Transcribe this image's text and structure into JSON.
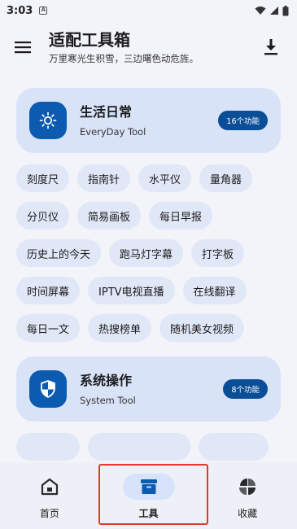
{
  "status_bar": {
    "time": "3:03",
    "notification_icon": "a-badge-icon",
    "wifi_icon": "wifi-icon",
    "signal_icon": "signal-icon",
    "battery_icon": "battery-icon"
  },
  "app_bar": {
    "title": "适配工具箱",
    "subtitle": "万里寒光生积雪，三边曙色动危旌。",
    "menu_icon": "menu-icon",
    "download_icon": "download-icon"
  },
  "categories": [
    {
      "title": "生活日常",
      "subtitle": "EveryDay Tool",
      "badge": "16个功能",
      "icon": "sun-icon",
      "tools": [
        "刻度尺",
        "指南针",
        "水平仪",
        "量角器",
        "分贝仪",
        "简易画板",
        "每日早报",
        "历史上的今天",
        "跑马灯字幕",
        "打字板",
        "时间屏幕",
        "IPTV电视直播",
        "在线翻译",
        "每日一文",
        "热搜榜单",
        "随机美女视频"
      ]
    },
    {
      "title": "系统操作",
      "subtitle": "System Tool",
      "badge": "8个功能",
      "icon": "shield-icon",
      "tools": []
    }
  ],
  "bottom_nav": {
    "items": [
      {
        "label": "首页",
        "icon": "home-icon",
        "active": false
      },
      {
        "label": "工具",
        "icon": "toolbox-icon",
        "active": true
      },
      {
        "label": "收藏",
        "icon": "favorites-icon",
        "active": false
      }
    ]
  },
  "colors": {
    "accent": "#0b5bb0",
    "card_bg": "#d9e3f8",
    "chip_bg": "#e0e7f6",
    "highlight": "#e2382c"
  }
}
